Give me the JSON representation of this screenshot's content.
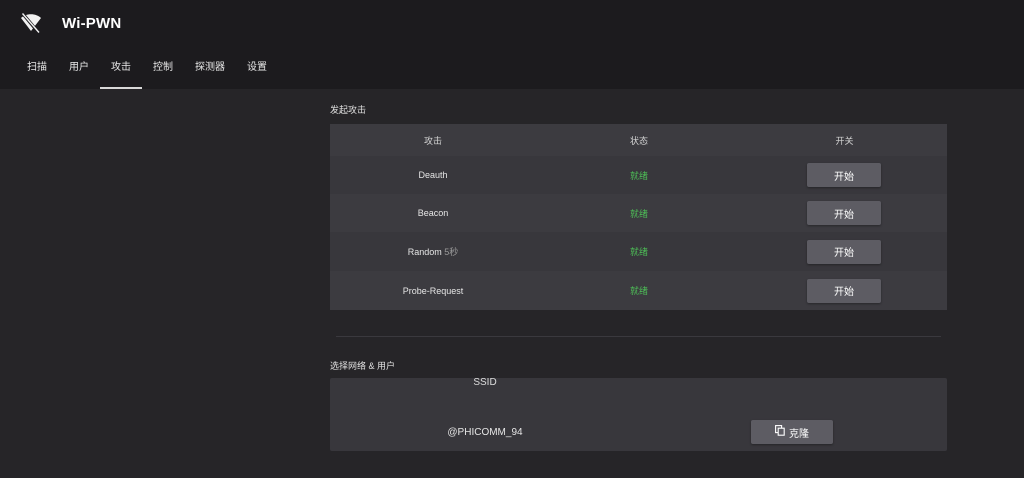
{
  "app": {
    "title": "Wi-PWN",
    "logo_icon": "wifi-off-icon"
  },
  "tabs": [
    {
      "label": "扫描",
      "active": false
    },
    {
      "label": "用户",
      "active": false
    },
    {
      "label": "攻击",
      "active": true
    },
    {
      "label": "控制",
      "active": false
    },
    {
      "label": "探测器",
      "active": false
    },
    {
      "label": "设置",
      "active": false
    }
  ],
  "attack": {
    "section_title": "发起攻击",
    "headers": {
      "attack": "攻击",
      "status": "状态",
      "switch": "开关"
    },
    "rows": [
      {
        "name": "Deauth",
        "suffix": "",
        "status": "就绪",
        "button": "开始"
      },
      {
        "name": "Beacon",
        "suffix": "",
        "status": "就绪",
        "button": "开始"
      },
      {
        "name": "Random",
        "suffix": "5秒",
        "status": "就绪",
        "button": "开始"
      },
      {
        "name": "Probe-Request",
        "suffix": "",
        "status": "就绪",
        "button": "开始"
      }
    ]
  },
  "network": {
    "section_title": "选择网络 & 用户",
    "ssid_header": "SSID",
    "ssid_value": "@PHICOMM_94",
    "clone_button": "克隆",
    "clone_icon": "copy-icon"
  },
  "colors": {
    "ready_status": "#4dbd56",
    "button": "#5d5c63",
    "card": "#38373c",
    "background": "#262528",
    "topbar": "#1c1b1e"
  }
}
